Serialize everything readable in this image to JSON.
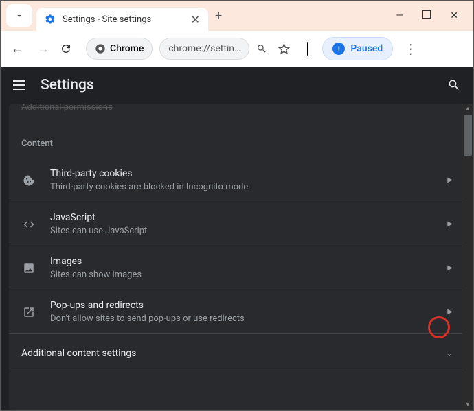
{
  "window": {
    "tab_title": "Settings - Site settings",
    "new_tab_glyph": "+",
    "minimize_glyph": "—",
    "close_glyph": "✕"
  },
  "toolbar": {
    "chrome_chip_label": "Chrome",
    "url_display": "chrome://settin…",
    "paused_label": "Paused",
    "paused_initial": "I"
  },
  "header": {
    "title": "Settings"
  },
  "panel": {
    "truncated_header": "Additional permissions",
    "section_label": "Content",
    "rows": [
      {
        "title": "Third-party cookies",
        "sub": "Third-party cookies are blocked in Incognito mode"
      },
      {
        "title": "JavaScript",
        "sub": "Sites can use JavaScript"
      },
      {
        "title": "Images",
        "sub": "Sites can show images"
      },
      {
        "title": "Pop-ups and redirects",
        "sub": "Don't allow sites to send pop-ups or use redirects"
      }
    ],
    "expand_row": "Additional content settings"
  }
}
